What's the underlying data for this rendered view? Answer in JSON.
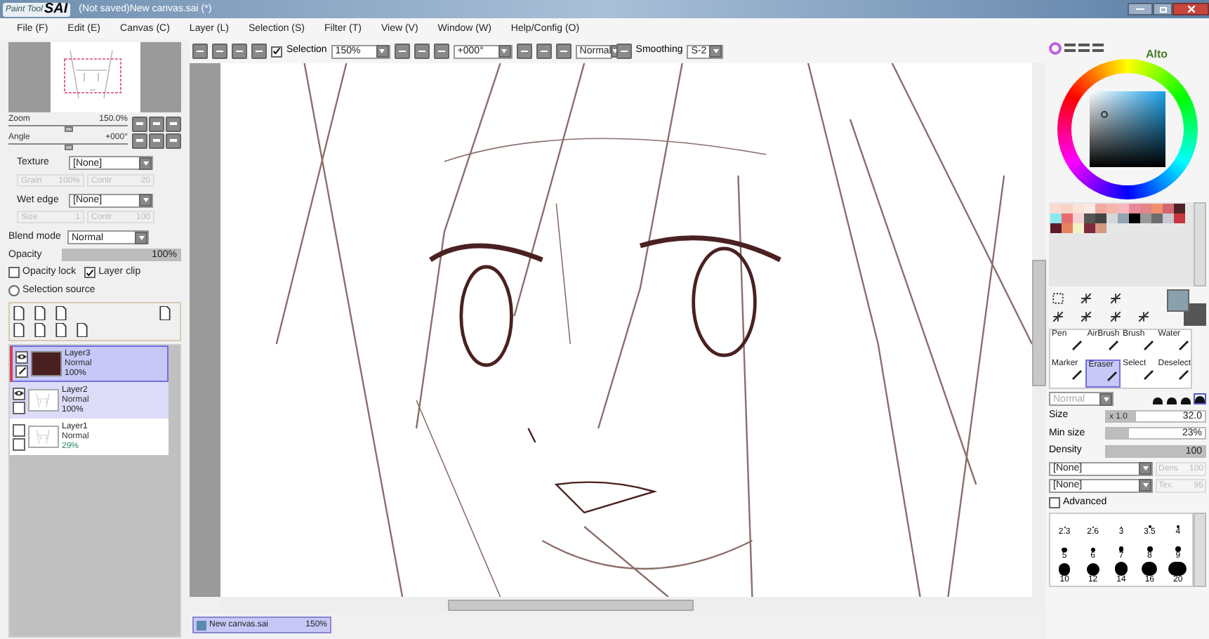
{
  "window": {
    "logo_small": "Paint Tool",
    "logo_big": "SAI",
    "title": "(Not saved)New canvas.sai (*)"
  },
  "menu": [
    "File (F)",
    "Edit (E)",
    "Canvas (C)",
    "Layer (L)",
    "Selection (S)",
    "Filter (T)",
    "View (V)",
    "Window (W)",
    "Help/Config (O)"
  ],
  "toolbar": {
    "selection": {
      "label": "Selection",
      "checked": true
    },
    "zoom": "150%",
    "angle": "+000°",
    "blend": "Normal",
    "smoothing_label": "Smoothing",
    "smoothing": "S-2"
  },
  "navigator": {
    "zoom": {
      "label": "Zoom",
      "value": "150.0%",
      "level": 0.5
    },
    "angle": {
      "label": "Angle",
      "value": "+000°",
      "level": 0.5
    }
  },
  "texture": {
    "label": "Texture",
    "value": "[None]",
    "params": [
      {
        "label": "Grain",
        "value": "100%"
      },
      {
        "label": "Contr",
        "value": "20"
      }
    ]
  },
  "wet_edge": {
    "label": "Wet edge",
    "value": "[None]",
    "params": [
      {
        "label": "Size",
        "value": "1"
      },
      {
        "label": "Contr",
        "value": "100"
      }
    ]
  },
  "blend_mode": {
    "label": "Blend mode",
    "value": "Normal"
  },
  "opacity": {
    "label": "Opacity",
    "value": "100%",
    "level": 1
  },
  "options": [
    {
      "label": "Opacity lock",
      "checked": false
    },
    {
      "label": "Layer clip",
      "checked": true
    }
  ],
  "selection_source": {
    "label": "Selection source",
    "selected": false
  },
  "layers": [
    {
      "name": "Layer3",
      "mode": "Normal",
      "opacity": "100%",
      "visible": true,
      "selected": true,
      "hovered": false,
      "kind": "fill"
    },
    {
      "name": "Layer2",
      "mode": "Normal",
      "opacity": "100%",
      "visible": true,
      "selected": false,
      "hovered": true,
      "kind": "sketch"
    },
    {
      "name": "Layer1",
      "mode": "Normal",
      "opacity": "29%",
      "visible": false,
      "selected": false,
      "hovered": false,
      "kind": "sketch"
    }
  ],
  "document_tab": {
    "name": "New canvas.sai",
    "zoom": "150%"
  },
  "mascot": {
    "label": "Alto"
  },
  "palette": [
    {
      "color": "#f9dccf"
    },
    {
      "color": "#f8d6c7"
    },
    {
      "color": "#fbe3da"
    },
    {
      "color": "#fde9e3"
    },
    {
      "color": "#f1a9a0"
    },
    {
      "color": "#f4b6a9"
    },
    {
      "color": "#f7b7bf"
    },
    {
      "color": "#e8899a"
    },
    {
      "color": "#e3868a"
    },
    {
      "color": "#f0906d"
    },
    {
      "color": "#d56671"
    },
    {
      "color": "#4f2325"
    },
    {
      "color": "#8ce8f0"
    },
    {
      "color": "#ea6b6e"
    },
    {
      "color": "#f7d1d4"
    },
    {
      "color": "#555555"
    },
    {
      "color": "#444444"
    },
    {
      "color": "#d7d7d7"
    },
    {
      "color": "#8fa5b3"
    },
    {
      "color": "#000000"
    },
    {
      "color": "#999999"
    },
    {
      "color": "#6d6d6d"
    },
    {
      "color": "#c7c7cf"
    },
    {
      "color": "#c9353d"
    },
    {
      "color": "#5c1b2a"
    },
    {
      "color": "#e7825f"
    },
    {
      "color": "#f4f0c9"
    },
    {
      "color": "#7d2a3c"
    },
    {
      "color": "#d49a80"
    }
  ],
  "current_color": {
    "color": "#8aa0ae"
  },
  "secondary_color": {
    "color": "#555555"
  },
  "brush_tools": [
    {
      "label": "Pen",
      "selected": false
    },
    {
      "label": "AirBrush",
      "selected": false
    },
    {
      "label": "Brush",
      "selected": false
    },
    {
      "label": "Water",
      "selected": false
    },
    {
      "label": "Marker",
      "selected": false
    },
    {
      "label": "Eraser",
      "selected": true
    },
    {
      "label": "Select",
      "selected": false
    },
    {
      "label": "Deselect",
      "selected": false
    }
  ],
  "brush_mode": {
    "value": "Normal",
    "disabled": true
  },
  "brush_shapes": [
    {
      "selected": false
    },
    {
      "selected": false
    },
    {
      "selected": false
    },
    {
      "selected": true
    }
  ],
  "size": {
    "label": "Size",
    "multiplier": "x 1.0",
    "value": "32.0",
    "level": 0.3
  },
  "min_size": {
    "label": "Min size",
    "value": "23%",
    "level": 0.23
  },
  "density": {
    "label": "Density",
    "value": "100",
    "level": 1
  },
  "brush_textures": [
    {
      "value": "[None]",
      "param": "Dens",
      "param_value": "100"
    },
    {
      "value": "[None]",
      "param": "Tex.",
      "param_value": "95"
    }
  ],
  "advanced": {
    "label": "Advanced",
    "checked": false
  },
  "brush_sizes": [
    {
      "label": "2.3"
    },
    {
      "label": "2.6"
    },
    {
      "label": "3"
    },
    {
      "label": "3.5"
    },
    {
      "label": "4"
    },
    {
      "label": "5"
    },
    {
      "label": "6"
    },
    {
      "label": "7"
    },
    {
      "label": "8"
    },
    {
      "label": "9"
    },
    {
      "label": "10"
    },
    {
      "label": "12"
    },
    {
      "label": "14"
    },
    {
      "label": "16"
    },
    {
      "label": "20"
    }
  ]
}
